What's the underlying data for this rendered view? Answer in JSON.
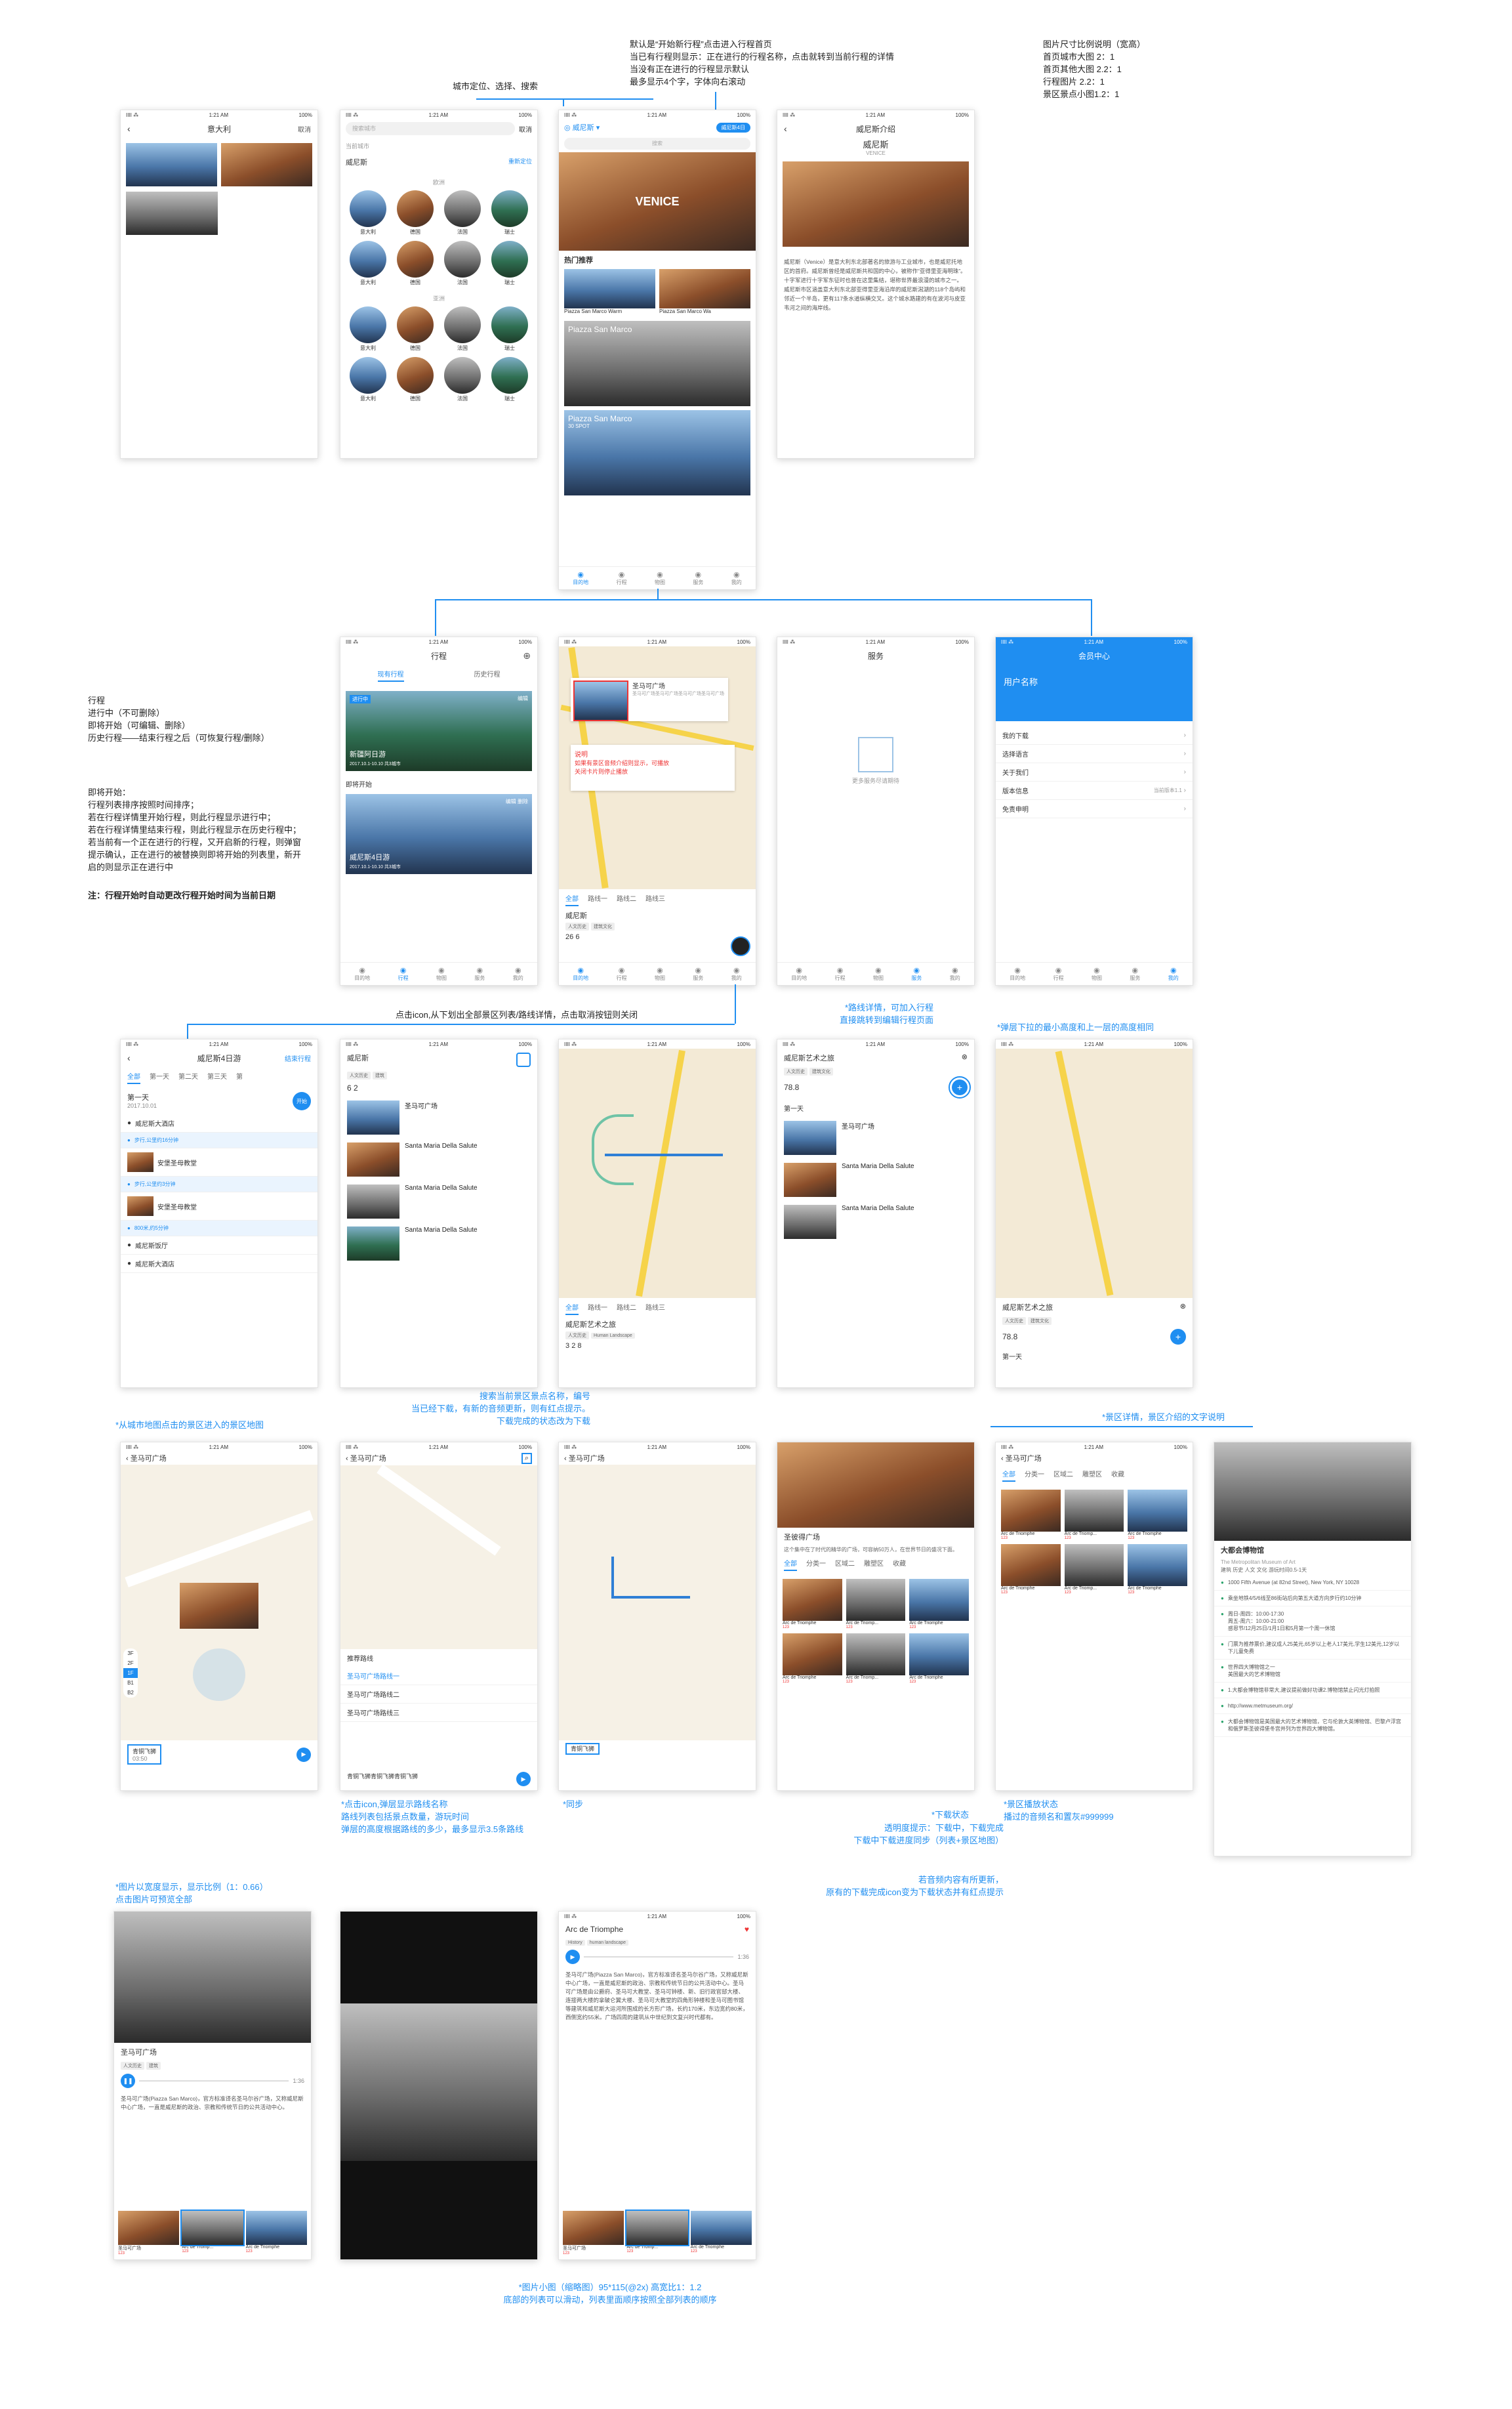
{
  "notes": {
    "top_default": "默认是“开始新行程”点击进入行程首页\n当已有行程则显示：正在进行的行程名称，点击就转到当前行程的详情\n当没有正在进行的行程显示默认\n最多显示4个字，字体向右滚动",
    "top_city": "城市定位、选择、搜索",
    "ratio": "图片尺寸比例说明（宽高）\n首页城市大图 2：1\n首页其他大图 2.2：1\n行程图片 2.2：1\n景区景点小图1.2：1",
    "itinerary": "行程\n进行中（不可删除）\n即将开始（可编辑、删除）\n历史行程——结束行程之后（可恢复行程/删除）",
    "sorting": "即将开始：\n行程列表排序按照时间排序；\n若在行程详情里开始行程，则此行程显示进行中；\n若在行程详情里结束行程，则此行程显示在历史行程中；\n若当前有一个正在进行的行程，又开启新的行程，则弹窗\n提示确认，正在进行的被替换则即将开始的列表里，新开\n启的则显示正在进行中",
    "sorting_bold": "注：行程开始时自动更改行程开始时间为当前日期",
    "icon_click": "点击icon,从下划出全部景区列表/路线详情，点击取消按钮则关闭",
    "route_detail": "*路线详情，可加入行程\n直接跳转到编辑行程页面",
    "popup_height": "*弹层下拉的最小高度和上一层的高度相同",
    "from_city_map": "*从城市地图点击的景区进入的景区地图",
    "search_spots": "搜索当前景区景点名称，编号\n当已经下载，有新的音频更新，则有红点提示。\n下载完成的状态改为下载",
    "route_popup": "*点击icon,弹层显示路线名称\n路线列表包括景点数量，游玩时间\n弹层的高度根据路线的多少，最多显示3.5条路线",
    "sync": "*同步",
    "intro_tabs": "*景区详情，景区介绍的文字说明",
    "dl_status": "*下载状态",
    "dl_detail": "透明度提示：下载中，下载完成\n下载中下载进度同步（列表+景区地图）",
    "spot_state": "*景区播放状态\n播过的音频名和置灰#999999",
    "update_hint": "若音频内容有所更新，\n原有的下载完成icon变为下载状态并有红点提示",
    "image_ratio": "*图片以宽度显示，显示比例（1：0.66）\n点击图片可预览全部",
    "thumb_note": "*图片小图（缩略图）95*115(@2x)   高宽比1：1.2\n底部的列表可以滑动，列表里面顺序按照全部列表的顺序"
  },
  "status": {
    "carrier": "IIII ⁂",
    "time": "1:21 AM",
    "battery": "100%"
  },
  "s1": {
    "title": "意大利",
    "right": "取消"
  },
  "s2": {
    "search": "搜索城市",
    "right": "取消",
    "current": "当前城市",
    "city": "威尼斯",
    "relocate": "重新定位",
    "sec1": "欧洲",
    "sec2": "亚洲",
    "cities": [
      "意大利",
      "德国",
      "法国",
      "瑞士",
      "意大利",
      "德国",
      "法国",
      "瑞士",
      "意大利",
      "德国",
      "法国",
      "瑞士",
      "意大利",
      "德国",
      "法国",
      "瑞士"
    ]
  },
  "s3": {
    "city": "威尼斯",
    "trip_btn": "威尼斯4日",
    "search": "搜索",
    "banner": "VENICE",
    "hot": "热门推荐",
    "card1": "Piazza San Marco Warm",
    "card2": "Piazza San Marco Wa",
    "big1": "Piazza San Marco",
    "big2": "Piazza San Marco",
    "big2sub": "30 SPOT",
    "tabs": [
      "目的地",
      "行程",
      "物图",
      "服务",
      "我的"
    ]
  },
  "s4": {
    "title": "威尼斯介绍",
    "name": "威尼斯",
    "en": "VENICE",
    "body": "威尼斯（Venice）是意大利东北部著名的旅游与工业城市，也是威尼托地区的首府。威尼斯曾经是威尼斯共和国的中心，被称作“亚得里亚海明珠”。十字军进行十字军东征时也曾在这里集结，堪称世界最浪漫的城市之一。威尼斯市区涵盖意大利东北部亚得里亚海沿岸的威尼斯潟湖的118个岛屿和邻近一个半岛，更有117条水道纵横交叉。这个城水路建的有在波河与皮亚韦河之间的海岸线。"
  },
  "s5": {
    "title": "行程",
    "tab_on": "现有行程",
    "tab_off": "历史行程",
    "ongoing": "进行中",
    "trip1": "新疆阿日游",
    "trip1_date": "2017.10.1-10.10  共3城市",
    "edit": "编辑",
    "upcoming": "即将开始",
    "trip2": "威尼斯4日游",
    "trip2_date": "2017.10.1-10.10  共3城市",
    "delete": "删除"
  },
  "s6": {
    "pin_name": "圣马可广场",
    "pin_desc": "圣马可广场圣马可广场圣马可广场圣马可广场",
    "note_title": "说明",
    "note": "如果有景区音频介绍则显示，可播放\n关闭卡片则停止播放",
    "tabs": [
      "全部",
      "路线一",
      "路线二",
      "路线三"
    ],
    "name": "威尼斯",
    "tags": [
      "人文历史",
      "建筑文化"
    ],
    "stat1": "26",
    "stat2": "6"
  },
  "s7": {
    "title": "服务",
    "empty": "更多服务尽请期待"
  },
  "s8": {
    "title": "会员中心",
    "user": "用户名称",
    "items": [
      "我的下载",
      "选择语言",
      "关于我们",
      "版本信息",
      "免责申明"
    ],
    "version": "当前版本1.1"
  },
  "s9": {
    "title": "威尼斯4日游",
    "end": "结束行程",
    "tabs": [
      "全部",
      "第一天",
      "第二天",
      "第三天",
      "第"
    ],
    "day": "第一天",
    "date": "2017.10.01",
    "start": "开始",
    "rows": [
      "威尼斯大酒店",
      "步行,公里约16分钟",
      "安堡圣母教堂",
      "步行,公里约3分钟",
      "安堡圣母教堂",
      "800米,约5分钟",
      "威尼斯饭厅",
      "威尼斯大酒店"
    ]
  },
  "s10": {
    "name": "威尼斯",
    "tags": [
      "人文历史",
      "建筑"
    ],
    "stat1": "6",
    "stat2": "2",
    "items": [
      "圣马可广场",
      "Santa Maria Della Salute",
      "Santa Maria Della Salute",
      "Santa Maria Della Salute"
    ]
  },
  "s11": {
    "tabs": [
      "全部",
      "路线一",
      "路线二",
      "路线三"
    ],
    "name": "威尼斯艺术之旅",
    "tags": [
      "人文历史",
      "Human Landscape"
    ],
    "a": "3",
    "b": "2",
    "c": "8"
  },
  "s12": {
    "name": "威尼斯艺术之旅",
    "tags": [
      "人文历史",
      "建筑文化"
    ],
    "stat": "78.8",
    "day": "第一天",
    "items": [
      "圣马可广场",
      "Santa Maria Della Salute",
      "Santa Maria Della Salute"
    ]
  },
  "s13": {
    "name": "威尼斯艺术之旅",
    "tags": [
      "人文历史",
      "建筑文化"
    ],
    "stat": "78.8",
    "day": "第一天"
  },
  "m1": {
    "title": "圣马可广场",
    "floors": [
      "3F",
      "2F",
      "1F",
      "B1",
      "B2"
    ],
    "pin": "圣马可广场",
    "audio": "青铜飞狮",
    "time": "03:50"
  },
  "m2": {
    "title": "圣马可广场",
    "popup_title": "推荐路线",
    "routes": [
      "圣马可广场路线一",
      "圣马可广场路线二",
      "圣马可广场路线三"
    ],
    "audio": "青铜飞狮青铜飞狮青铜飞狮"
  },
  "m3": {
    "title": "圣马可广场",
    "audio": "青铜飞狮"
  },
  "m4": {
    "title": "圣彼得广场",
    "desc": "这个集中在了时代的精华的广场，可容纳50万人，在世界节日的盛况下面。",
    "tabs": [
      "全部",
      "分类一",
      "区域二",
      "雕塑区",
      "收藏"
    ],
    "grid": [
      "Arc de Triomphe",
      "Arc de Triomp...",
      "Arc de Triomphe",
      "Arc de Triomphe",
      "Arc de Triomp...",
      "Arc de Triomphe"
    ]
  },
  "m5": {
    "title": "圣马可广场",
    "tabs": [
      "全部",
      "分类一",
      "区域二",
      "雕塑区",
      "收藏"
    ],
    "grid": [
      "Arc de Triomphe",
      "Arc de Triomp...",
      "Arc de Triomphe",
      "Arc de Triomphe",
      "Arc de Triomp...",
      "Arc de Triomphe"
    ]
  },
  "m6": {
    "name": "大都会博物馆",
    "en": "The Metropolitan Museum of Art",
    "tags": [
      "建筑",
      "历史",
      "人文",
      "文化"
    ],
    "time": "游玩时间0.5-1天",
    "info": [
      "1000 Fifth Avenue (at 82nd Street), New York, NY 10028",
      "乘坐地铁4/5/6线至86街站后向第五大道方向步行约10分钟",
      "周日-周四：10:00-17:30\n周五-周六：10:00-21:00\n感恩节/12月25日/1月1日和5月第一个周一休馆",
      "门票为推荐票价,建议成人25美元,65岁以上老人17美元,学生12美元,12岁以下儿童免费",
      "世界四大博物馆之一\n美国最大的艺术博物馆",
      "1.大都会博物馆非常大,建议提前做好功课2.博物馆禁止闪光灯拍照",
      "http://www.metmuseum.org/",
      "大都会博物馆是美国最大的艺术博物馆，它与伦敦大英博物馆、巴黎卢浮宫和俄罗斯圣彼得堡冬宫并列为世界四大博物馆。"
    ]
  },
  "d1": {
    "name": "圣马可广场",
    "tags": [
      "人文历史",
      "建筑"
    ],
    "time": "1:36",
    "body": "圣马可广场(Piazza San Marco)，官方标准译名圣马尔谷广场，又称威尼斯中心广场，一直是威尼斯的政治、宗教和传统节日的公共活动中心。"
  },
  "d3": {
    "name": "Arc de Triomphe",
    "tags": [
      "History",
      "human landscape"
    ],
    "time": "1:36",
    "body": "圣马可广场(Piazza San Marco)，官方标准译名圣马尔谷广场，又称威尼斯中心广场，一直是威尼斯的政治、宗教和传统节日的公共活动中心。圣马可广场是由公爵府、圣马可大教堂、圣马可钟楼、新、旧行政官邸大楼、连接两大楼的拿破仑翼大楼、圣马可大教堂的四角形钟楼和圣马可图书馆等建筑和威尼斯大运河所围成的长方形广场，长约170米，东边宽约80米，西侧宽约55米。广场四周的建筑从中世纪到文复兴时代都有。"
  },
  "strip": [
    "圣马可广场",
    "Arc de Tromp...",
    "Arc de Triomphe"
  ],
  "strip_count": "123"
}
